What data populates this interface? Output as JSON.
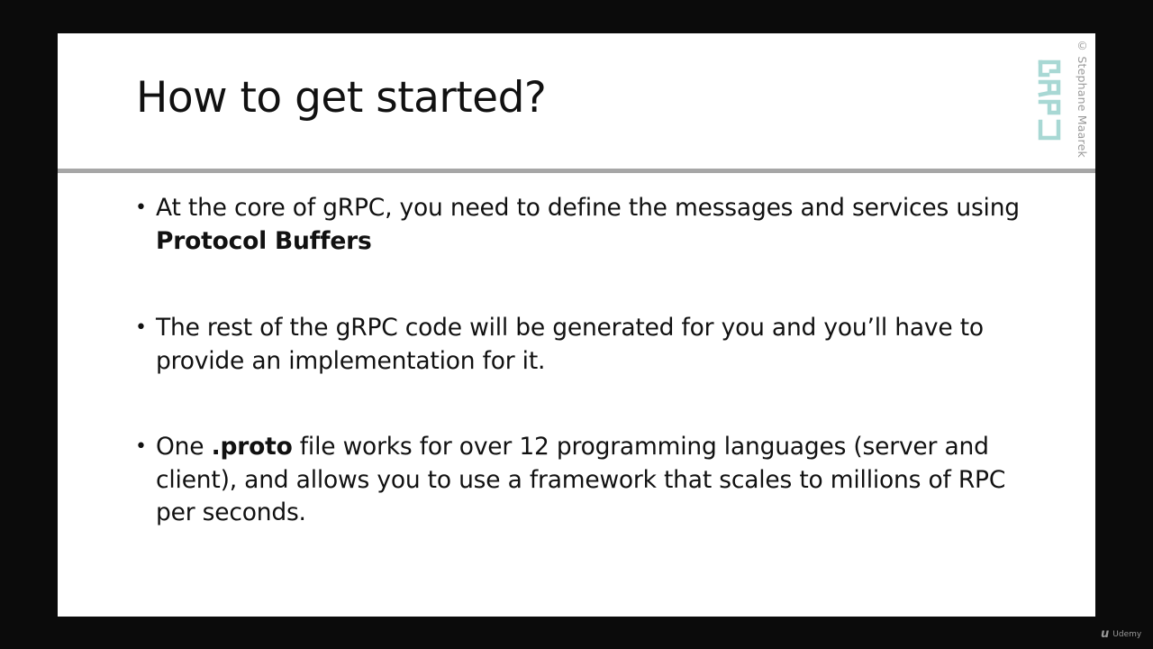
{
  "slide": {
    "title": "How to get started?",
    "copyright": "© Stephane Maarek",
    "logo_text": "gRPC",
    "accent_color": "#a8d8d4"
  },
  "bullets": [
    {
      "marker": "•",
      "parts": [
        {
          "text": "At the core of gRPC, you need to define the messages and services using ",
          "bold": false
        },
        {
          "text": "Protocol Buffers",
          "bold": true
        }
      ]
    },
    {
      "marker": "•",
      "parts": [
        {
          "text": "The rest of the gRPC code will be generated for you and you’ll have to provide an implementation for it.",
          "bold": false
        }
      ]
    },
    {
      "marker": "•",
      "parts": [
        {
          "text": "One ",
          "bold": false
        },
        {
          "text": ".proto",
          "bold": true
        },
        {
          "text": " file works for over 12 programming languages (server and client), and allows you to use a framework that scales to millions of RPC per seconds.",
          "bold": false
        }
      ]
    }
  ],
  "watermark": {
    "icon": "udemy-logo-icon",
    "label": "Udemy"
  }
}
